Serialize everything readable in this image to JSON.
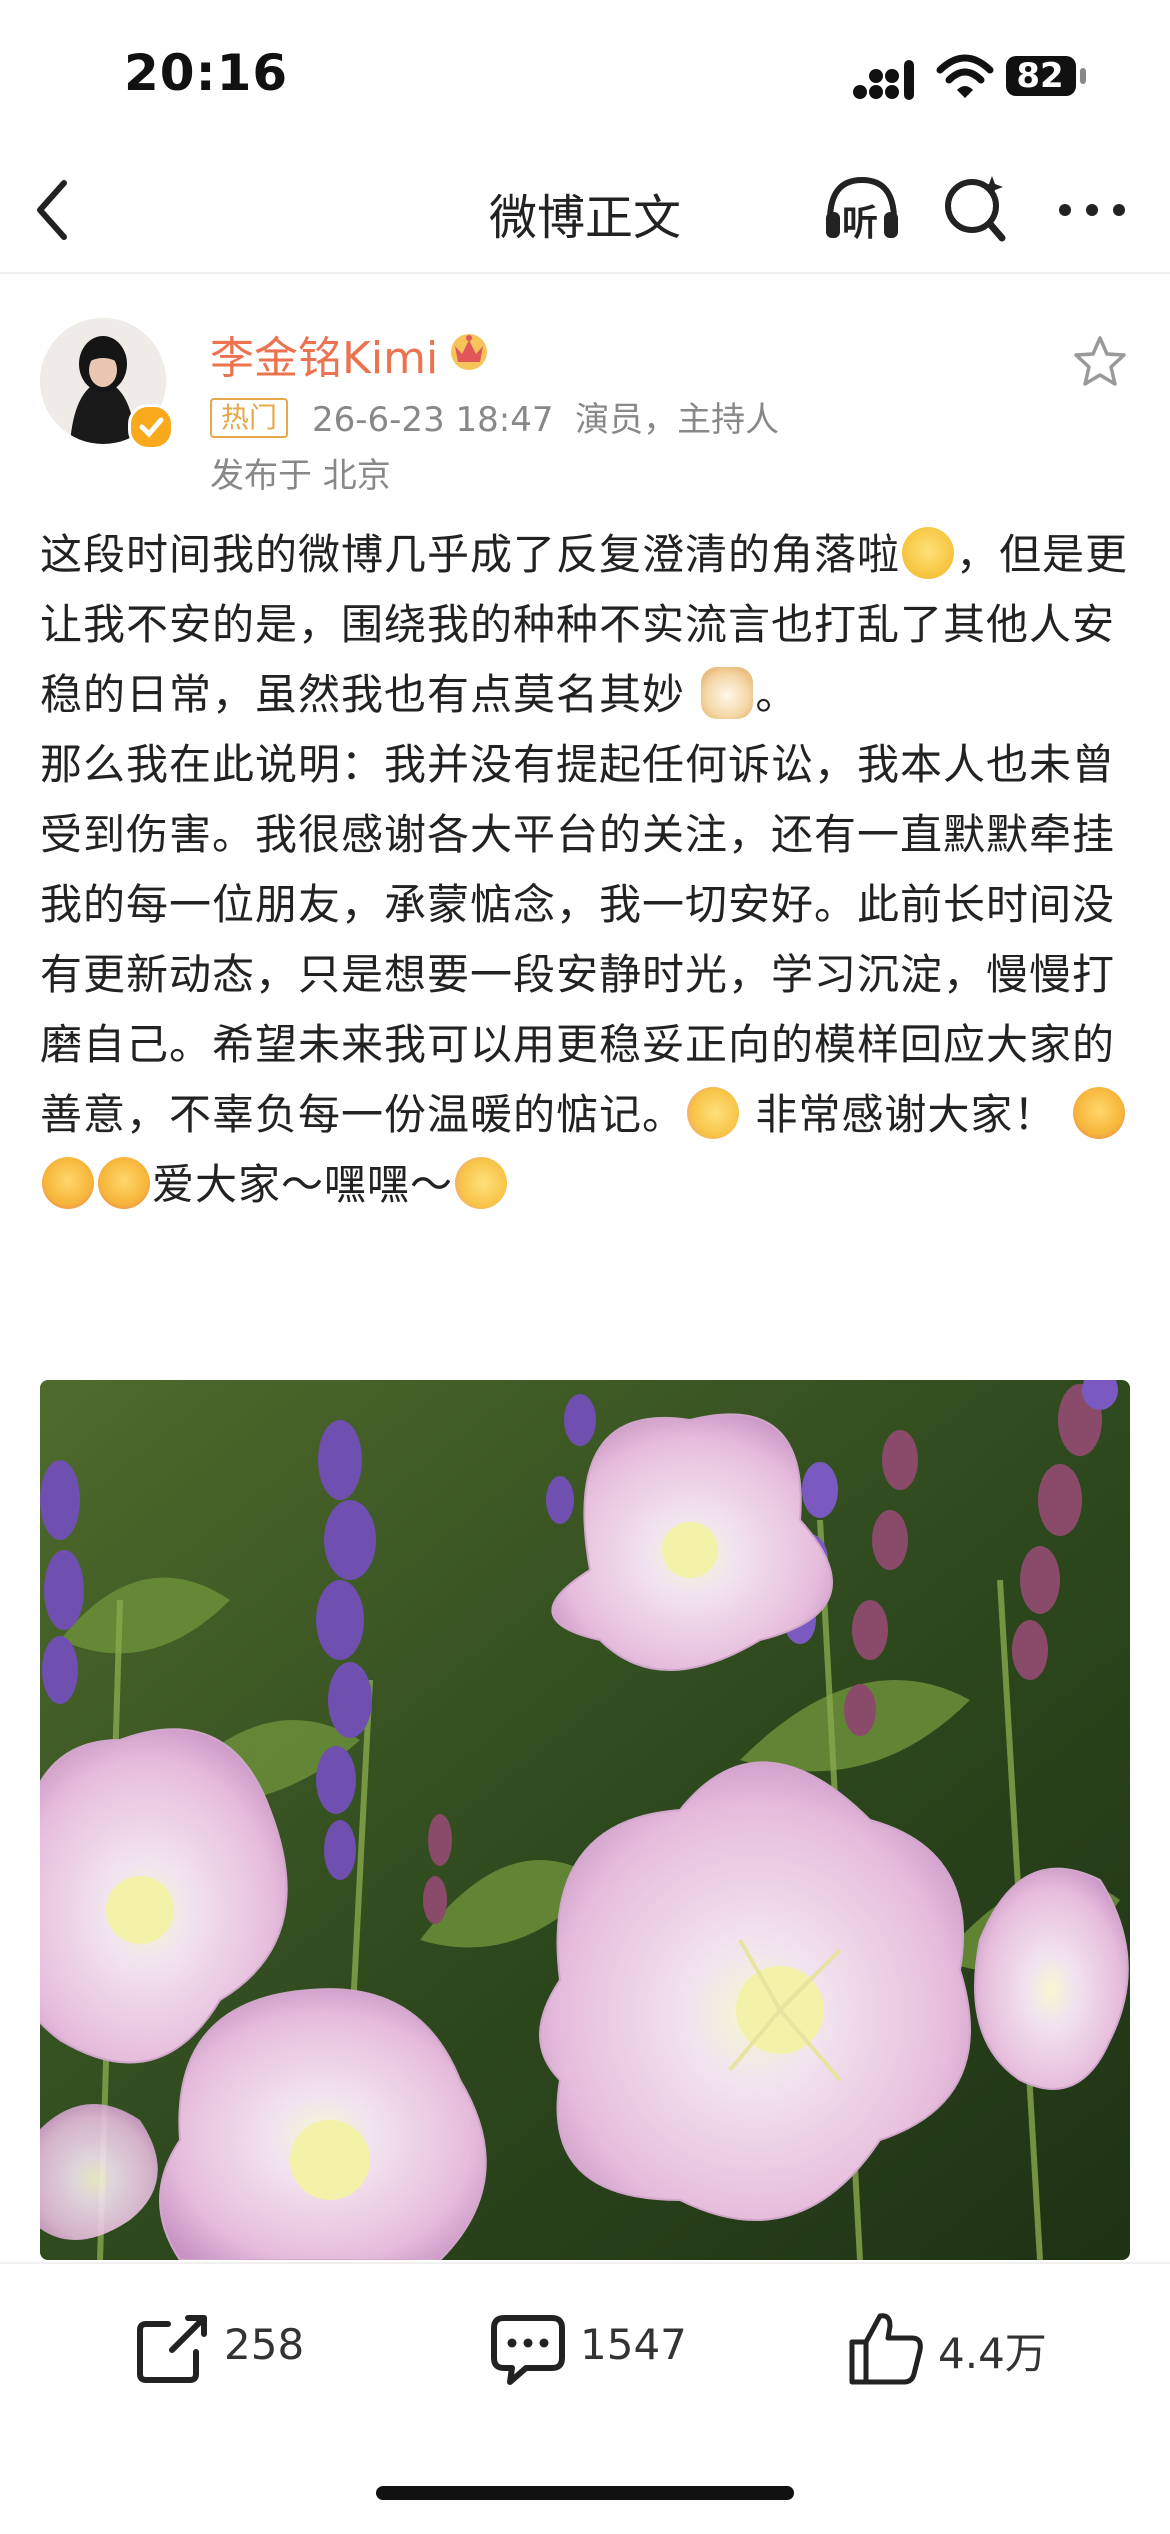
{
  "status_bar": {
    "time": "20:16",
    "battery": "82"
  },
  "nav": {
    "title": "微博正文",
    "listen_label": "听"
  },
  "author": {
    "name": "李金铭Kimi",
    "badge": "热门",
    "meta": "26-6-23 18:47  演员，主持人",
    "location": "发布于 北京"
  },
  "post": {
    "paragraph1_part1": "这段时间我的微博几乎成了反复澄清的角落啦",
    "paragraph1_part2": "，但是更让我不安的是，围绕我的种种不实流言也打乱了其他人安稳的日常，虽然我也有点莫名其妙",
    "paragraph1_part3": "。",
    "paragraph2_part1": "那么我在此说明：我并没有提起任何诉讼，我本人也未曾受到伤害。我很感谢各大平台的关注，还有一直默默牵挂我的每一位朋友，承蒙惦念，我一切安好。此前长时间没有更新动态，只是想要一段安静时光，学习沉淀，慢慢打磨自己。希望未来我可以用更稳妥正向的模样回应大家的善意，不辜负每一份温暖的惦记。",
    "paragraph2_part2": " 非常感谢大家！ ",
    "paragraph2_part3": "爱大家～嘿嘿～",
    "emojis": [
      "laugh-cry-emoji",
      "dog-emoji",
      "flower-hug-emoji",
      "kiss-emoji",
      "kiss-emoji",
      "kiss-emoji",
      "flower-hug-emoji"
    ]
  },
  "actions": {
    "repost_count": "258",
    "comment_count": "1547",
    "like_count": "4.4万"
  },
  "colors": {
    "author_name": "#eb7350",
    "hot_badge": "#e8a64a",
    "meta_text": "#888888"
  }
}
